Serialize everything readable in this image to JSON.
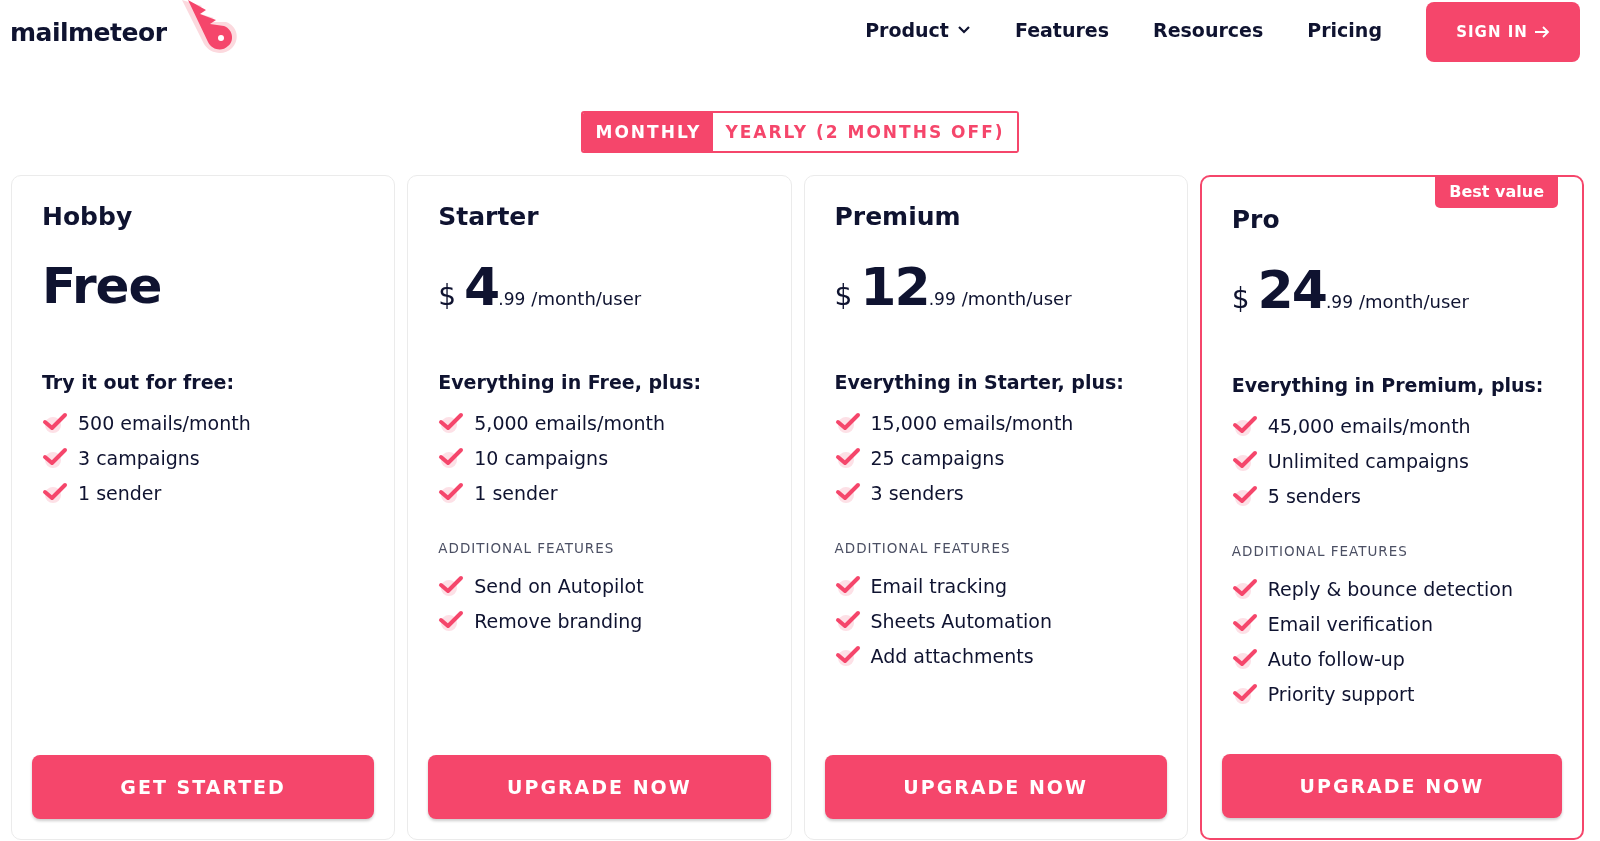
{
  "nav": {
    "logo": "mailmeteor",
    "items": [
      {
        "label": "Product",
        "dropdown": true
      },
      {
        "label": "Features",
        "dropdown": false
      },
      {
        "label": "Resources",
        "dropdown": false
      },
      {
        "label": "Pricing",
        "dropdown": false
      }
    ],
    "sign_in": "SIGN IN"
  },
  "billing_toggle": [
    {
      "label": "MONTHLY",
      "selected": true
    },
    {
      "label": "YEARLY (2 MONTHS OFF)",
      "selected": false
    }
  ],
  "plans": [
    {
      "name": "Hobby",
      "featured": false,
      "price": {
        "kind": "free",
        "label": "Free"
      },
      "intro": "Try it out for free:",
      "features": [
        "500 emails/month",
        "3 campaigns",
        "1 sender"
      ],
      "button": "GET STARTED"
    },
    {
      "name": "Starter",
      "featured": false,
      "price": {
        "kind": "paid",
        "currency": "$",
        "amount": "4",
        "cents": ".99",
        "period": "/month/user"
      },
      "intro": "Everything in Free, plus:",
      "features": [
        "5,000 emails/month",
        "10 campaigns",
        "1 sender"
      ],
      "additional_title": "ADDITIONAL FEATURES",
      "additional": [
        "Send on Autopilot",
        "Remove branding"
      ],
      "button": "UPGRADE NOW"
    },
    {
      "name": "Premium",
      "featured": false,
      "price": {
        "kind": "paid",
        "currency": "$",
        "amount": "12",
        "cents": ".99",
        "period": "/month/user"
      },
      "intro": "Everything in Starter, plus:",
      "features": [
        "15,000 emails/month",
        "25 campaigns",
        "3 senders"
      ],
      "additional_title": "ADDITIONAL FEATURES",
      "additional": [
        "Email tracking",
        "Sheets Automation",
        "Add attachments"
      ],
      "button": "UPGRADE NOW"
    },
    {
      "name": "Pro",
      "featured": true,
      "badge": "Best value",
      "price": {
        "kind": "paid",
        "currency": "$",
        "amount": "24",
        "cents": ".99",
        "period": "/month/user"
      },
      "intro": "Everything in Premium, plus:",
      "features": [
        "45,000 emails/month",
        "Unlimited campaigns",
        "5 senders"
      ],
      "additional_title": "ADDITIONAL FEATURES",
      "additional": [
        "Reply & bounce detection",
        "Email verification",
        "Auto follow-up",
        "Priority support"
      ],
      "button": "UPGRADE NOW"
    }
  ]
}
